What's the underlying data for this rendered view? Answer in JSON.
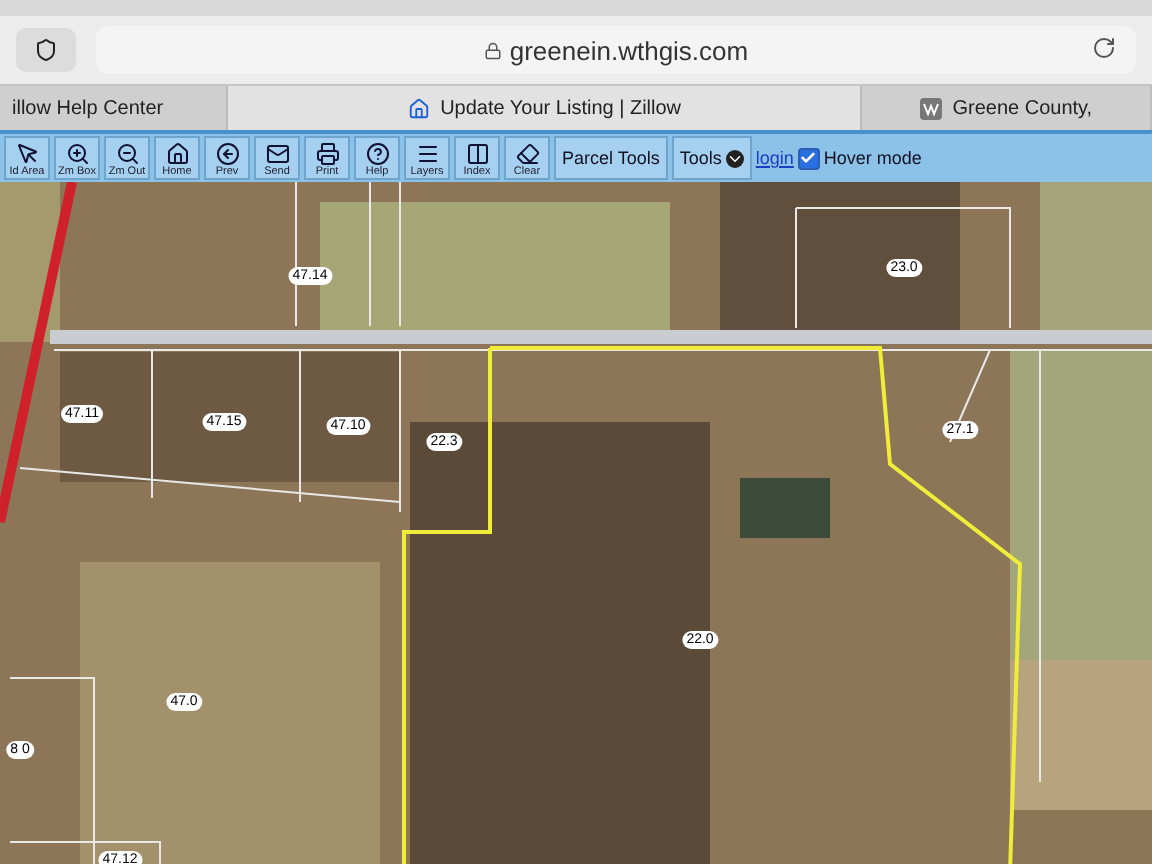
{
  "address_bar": {
    "url": "greenein.wthgis.com"
  },
  "tabs": [
    {
      "label": "illow Help Center",
      "selected": false,
      "kind": "plain"
    },
    {
      "label": "Update Your Listing | Zillow",
      "selected": true,
      "kind": "zillow"
    },
    {
      "label": "Greene County,",
      "selected": false,
      "kind": "county"
    }
  ],
  "toolbar": {
    "buttons": [
      {
        "label": "Id Area",
        "kind": "pointer"
      },
      {
        "label": "Zm Box",
        "kind": "zoomin"
      },
      {
        "label": "Zm Out",
        "kind": "zoomout"
      },
      {
        "label": "Home",
        "kind": "home"
      },
      {
        "label": "Prev",
        "kind": "prev"
      },
      {
        "label": "Send",
        "kind": "mail"
      },
      {
        "label": "Print",
        "kind": "print"
      },
      {
        "label": "Help",
        "kind": "help"
      },
      {
        "label": "Layers",
        "kind": "layers"
      },
      {
        "label": "Index",
        "kind": "index"
      },
      {
        "label": "Clear",
        "kind": "eraser"
      }
    ],
    "parcel_tools": "Parcel Tools",
    "tools": "Tools",
    "login": "login",
    "hover_mode": {
      "label": "Hover mode",
      "checked": true
    }
  },
  "map": {
    "parcel_labels": [
      "47.14",
      "23.0",
      "47.11",
      "47.15",
      "47.10",
      "22.3",
      "27.1",
      "22.0",
      "47.0",
      "8 0",
      "47.12"
    ]
  }
}
